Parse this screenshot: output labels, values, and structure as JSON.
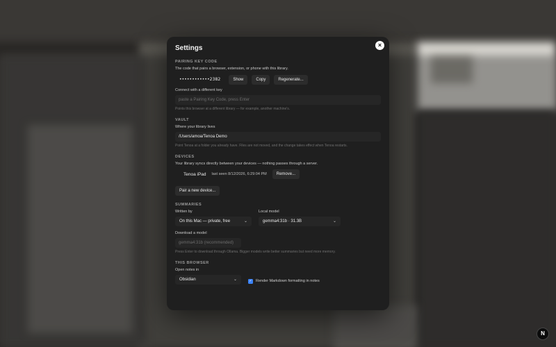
{
  "modal": {
    "title": "Settings",
    "close_glyph": "×"
  },
  "pairing": {
    "section_label": "PAIRING KEY CODE",
    "description": "The code that pairs a browser, extension, or phone with this library.",
    "masked_key": "••••••••••••2382",
    "show_label": "Show",
    "copy_label": "Copy",
    "regenerate_label": "Regenerate...",
    "connect_label": "Connect with a different key",
    "connect_placeholder": "paste a Pairing Key Code, press Enter",
    "connect_hint": "Points this browser at a different library — for example, another machine's."
  },
  "vault": {
    "section_label": "VAULT",
    "field_label": "Where your library lives",
    "path_value": "/Users/amoa/Tenoa Demo",
    "hint": "Point Tenoa at a folder you already have. Files are not moved, and the change takes effect when Tenoa restarts."
  },
  "devices": {
    "section_label": "DEVICES",
    "description": "Your library syncs directly between your devices — nothing passes through a server.",
    "items": [
      {
        "name": "Tenoa iPad",
        "last_seen": "last seen 8/12/2026, 6:29:04 PM",
        "remove_label": "Remove..."
      }
    ],
    "pair_label": "Pair a new device..."
  },
  "summaries": {
    "section_label": "SUMMARIES",
    "written_by_label": "Written by",
    "written_by_value": "On this Mac — private, free",
    "local_model_label": "Local model",
    "local_model_value": "gemma4:31b · 31.3B",
    "download_label": "Download a model",
    "download_placeholder": "gemma4:31b (recommended)",
    "download_hint": "Press Enter to download through Ollama. Bigger models write better summaries but need more memory."
  },
  "browser": {
    "section_label": "THIS BROWSER",
    "open_notes_label": "Open notes in",
    "open_notes_value": "Obsidian",
    "render_markdown_label": "Render Markdown formatting in notes",
    "render_markdown_checked": true
  },
  "app": {
    "logo_letter": "N"
  },
  "icons": {
    "chevron": "chevron-down-icon",
    "check": "check-icon"
  }
}
